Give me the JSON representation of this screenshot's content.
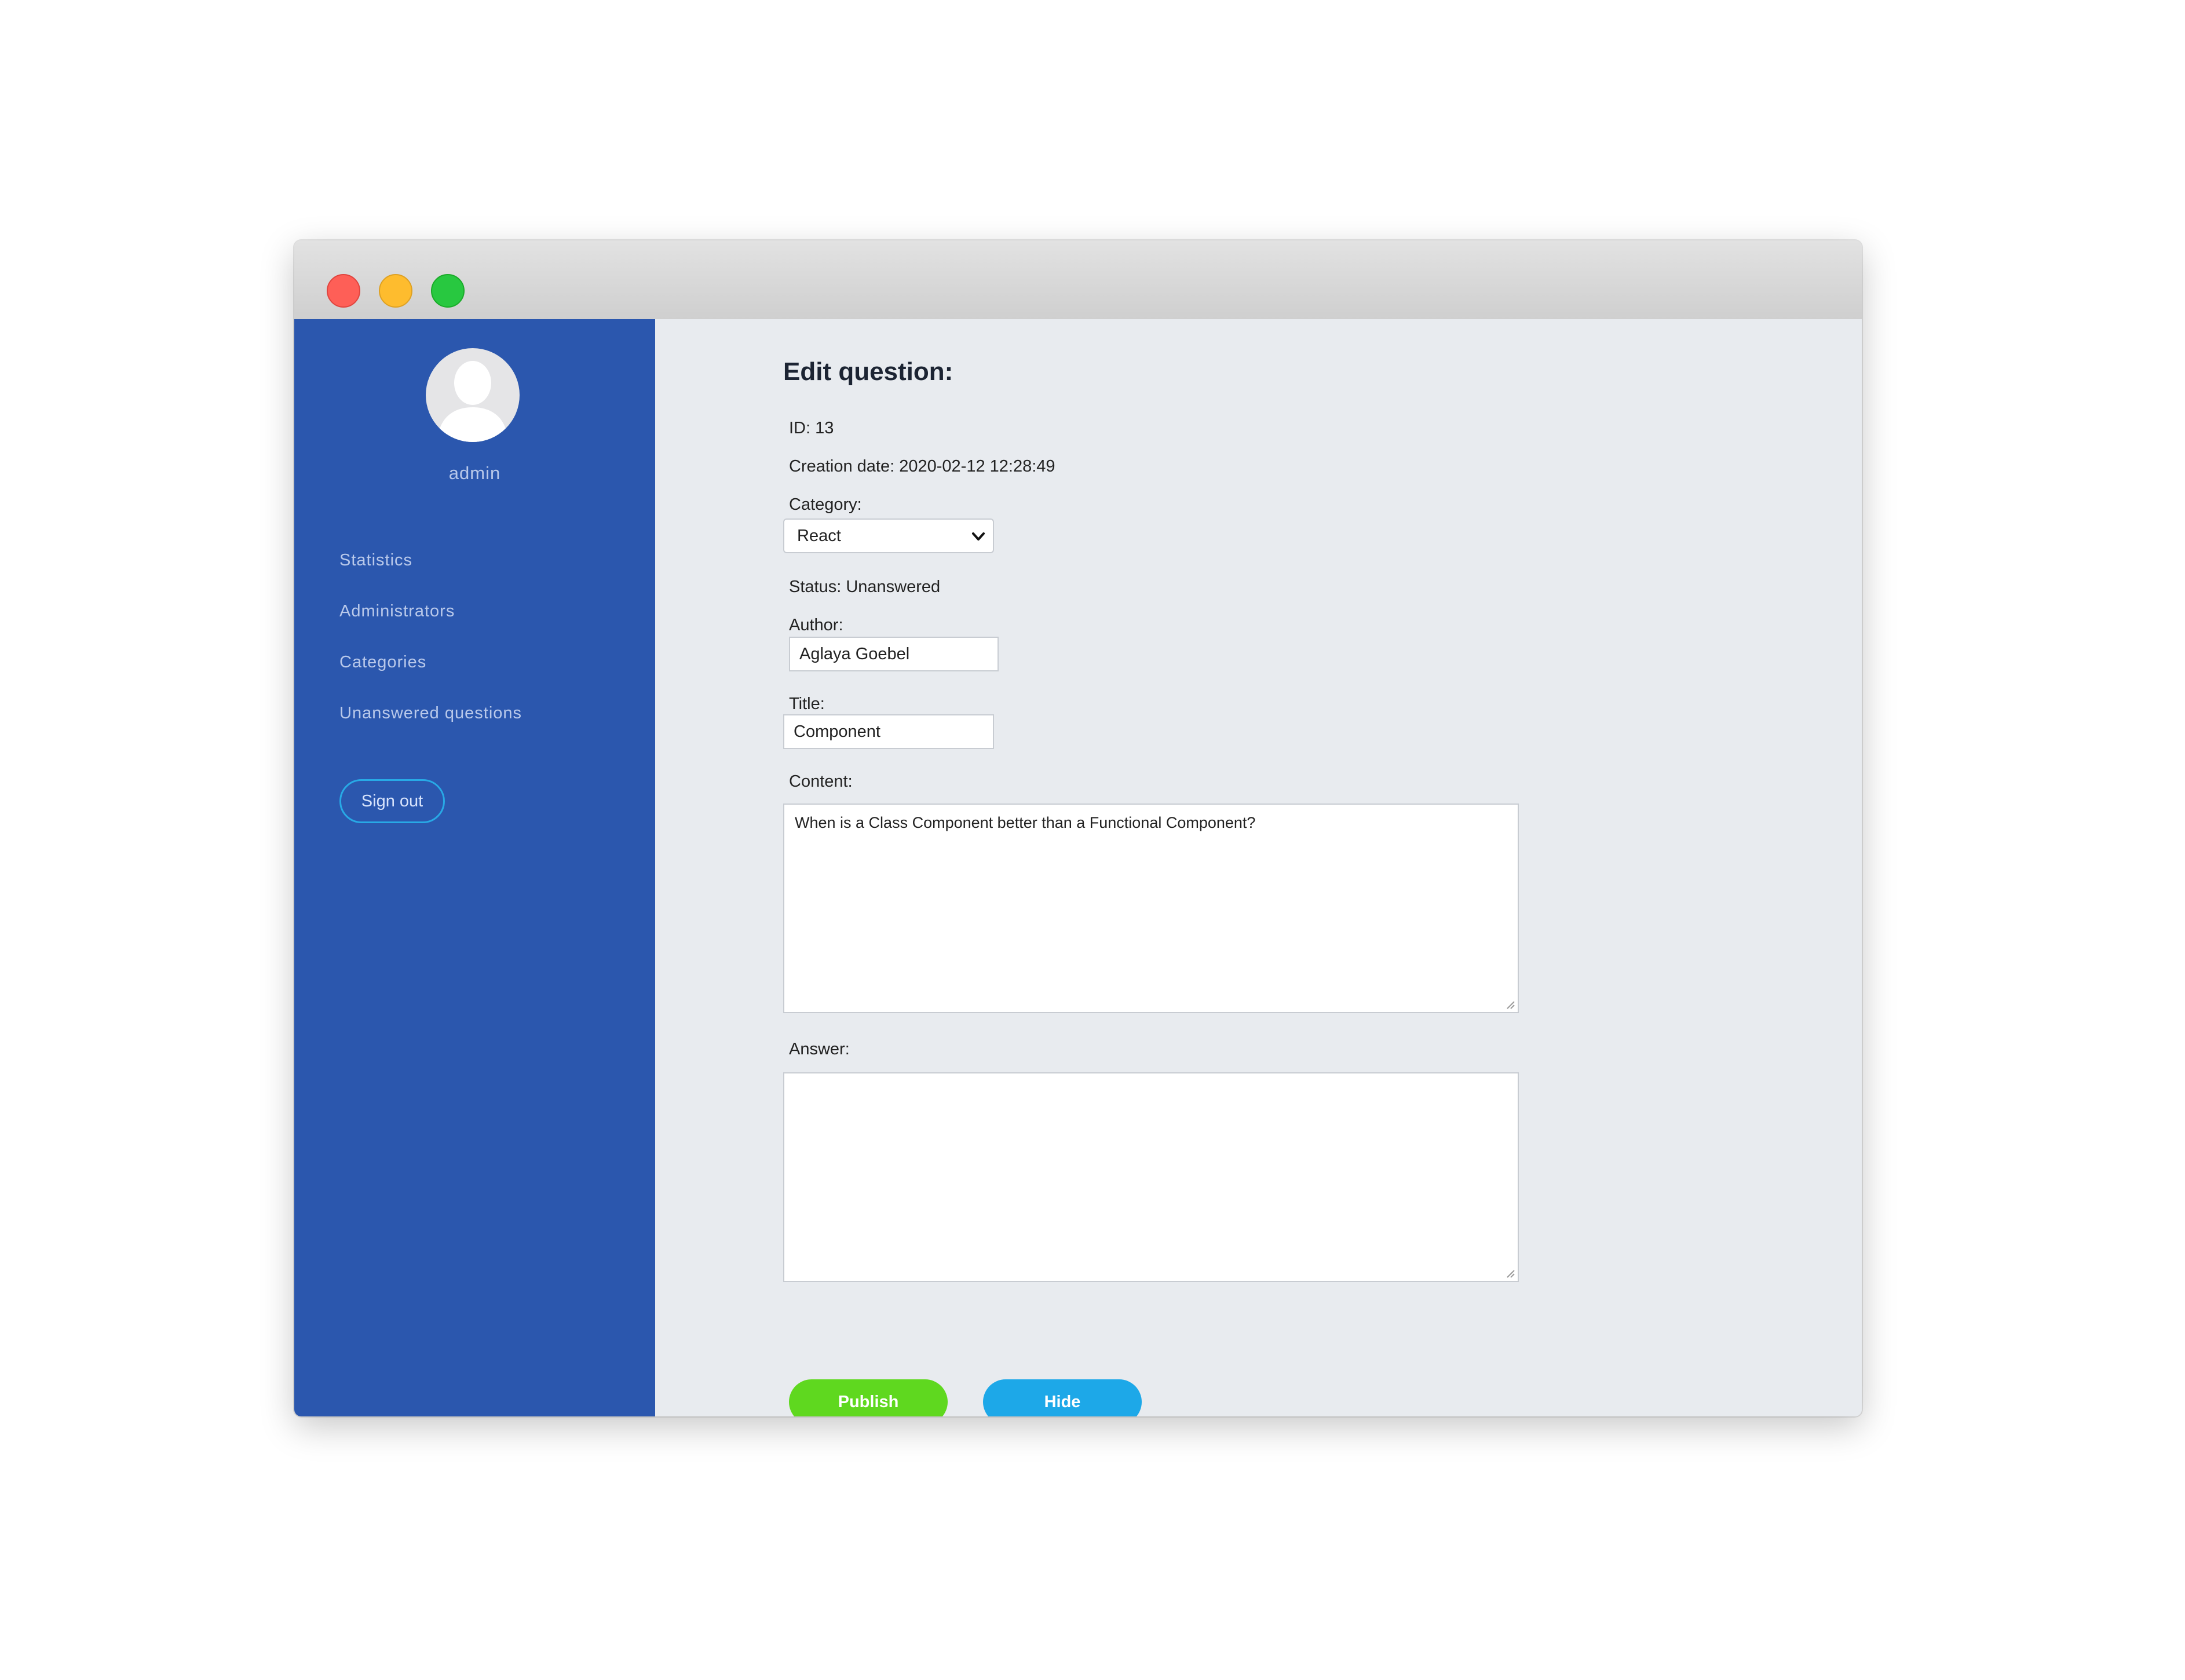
{
  "user": {
    "name": "admin"
  },
  "sidebar": {
    "items": [
      {
        "label": "Statistics"
      },
      {
        "label": "Administrators"
      },
      {
        "label": "Categories"
      },
      {
        "label": "Unanswered questions"
      }
    ],
    "sign_out_label": "Sign out"
  },
  "form": {
    "title": "Edit question:",
    "id_text": "ID: 13",
    "creation_text": "Creation date: 2020-02-12 12:28:49",
    "category_label": "Category:",
    "category_value": "React",
    "status_text": "Status: Unanswered",
    "author_label": "Author:",
    "author_value": "Aglaya Goebel",
    "title_label": "Title:",
    "title_value": "Component",
    "content_label": "Content:",
    "content_value": "When is a Class Component better than a Functional Component?",
    "answer_label": "Answer:",
    "answer_value": "",
    "publish_label": "Publish",
    "hide_label": "Hide"
  },
  "colors": {
    "sidebar": "#2b57ae",
    "publish": "#5fd81f",
    "hide": "#1da8e8",
    "sign_out_border": "#28a9e6"
  },
  "icons": [
    "user-avatar-icon",
    "chevron-down-icon",
    "resize-grip-icon"
  ]
}
